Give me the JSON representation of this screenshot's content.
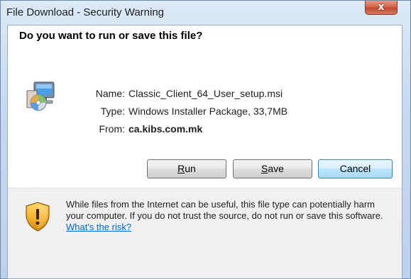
{
  "window": {
    "title": "File Download - Security Warning",
    "close_label": "x"
  },
  "dialog": {
    "heading": "Do you want to run or save this file?",
    "file": {
      "name_label": "Name:",
      "name_value": "Classic_Client_64_User_setup.msi",
      "type_label": "Type:",
      "type_value": "Windows Installer Package, 33,7MB",
      "from_label": "From:",
      "from_value": "ca.kibs.com.mk"
    },
    "buttons": {
      "run_accesskey": "R",
      "run_rest": "un",
      "save_accesskey": "S",
      "save_rest": "ave",
      "cancel_label": "Cancel"
    },
    "warning": {
      "text": "While files from the Internet can be useful, this file type can potentially harm your computer. If you do not trust the source, do not run or save this software. ",
      "link": "What's the risk?"
    }
  },
  "icons": {
    "file_icon": "msi-installer-icon",
    "warning_icon": "security-shield-icon"
  },
  "colors": {
    "link": "#0066cc",
    "close_button": "#c24a30",
    "default_button_border": "#3c7fb1"
  }
}
